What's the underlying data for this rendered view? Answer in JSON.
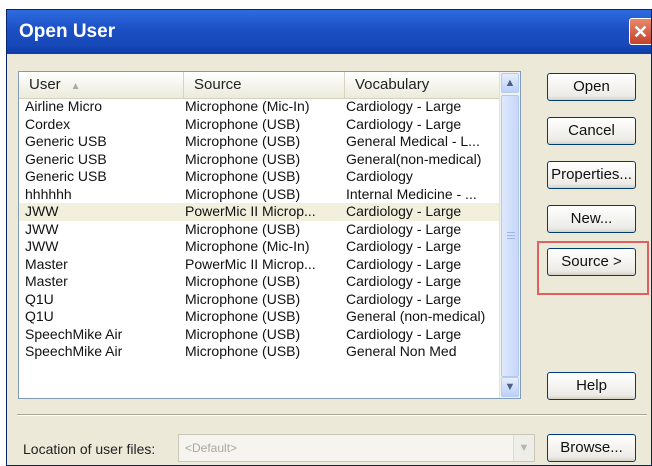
{
  "window": {
    "title": "Open User",
    "close_glyph": "✕"
  },
  "list": {
    "columns": [
      {
        "label": "User"
      },
      {
        "label": "Source"
      },
      {
        "label": "Vocabulary"
      }
    ],
    "sort_glyph": "▲",
    "rows": [
      {
        "user": "Airline Micro",
        "source": "Microphone (Mic-In)",
        "vocab": "Cardiology - Large"
      },
      {
        "user": "Cordex",
        "source": "Microphone (USB)",
        "vocab": "Cardiology - Large"
      },
      {
        "user": "Generic USB",
        "source": "Microphone (USB)",
        "vocab": "General Medical - L..."
      },
      {
        "user": "Generic USB",
        "source": "Microphone (USB)",
        "vocab": "General(non-medical)"
      },
      {
        "user": "Generic USB",
        "source": "Microphone (USB)",
        "vocab": "Cardiology"
      },
      {
        "user": "hhhhhh",
        "source": "Microphone (USB)",
        "vocab": "Internal Medicine - ..."
      },
      {
        "user": "JWW",
        "source": "PowerMic II Microp...",
        "vocab": "Cardiology - Large",
        "selected": true
      },
      {
        "user": "JWW",
        "source": "Microphone (USB)",
        "vocab": "Cardiology - Large"
      },
      {
        "user": "JWW",
        "source": "Microphone (Mic-In)",
        "vocab": "Cardiology - Large"
      },
      {
        "user": "Master",
        "source": "PowerMic II Microp...",
        "vocab": "Cardiology - Large"
      },
      {
        "user": "Master",
        "source": "Microphone (USB)",
        "vocab": "Cardiology - Large"
      },
      {
        "user": "Q1U",
        "source": "Microphone (USB)",
        "vocab": "Cardiology - Large"
      },
      {
        "user": "Q1U",
        "source": "Microphone (USB)",
        "vocab": "General (non-medical)"
      },
      {
        "user": "SpeechMike Air",
        "source": "Microphone (USB)",
        "vocab": "Cardiology - Large"
      },
      {
        "user": "SpeechMike Air",
        "source": "Microphone (USB)",
        "vocab": "General Non Med"
      }
    ],
    "scroll_up_glyph": "▲",
    "scroll_down_glyph": "▼"
  },
  "buttons": {
    "open": "Open",
    "cancel": "Cancel",
    "properties": "Properties...",
    "new": "New...",
    "source": "Source >",
    "help": "Help",
    "browse": "Browse..."
  },
  "location": {
    "label": "Location of user files:",
    "value": "<Default>",
    "dropdown_glyph": "▼"
  }
}
